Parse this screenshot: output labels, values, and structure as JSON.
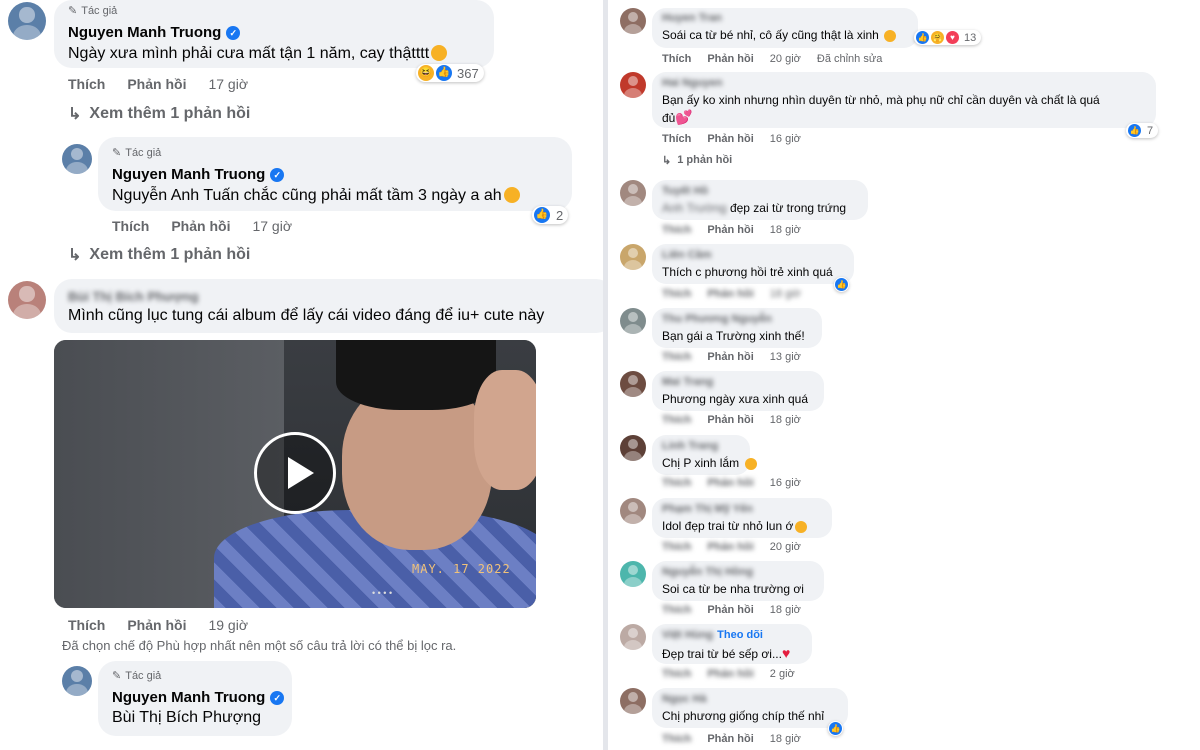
{
  "left": {
    "c1": {
      "author_tag": "Tác giả",
      "name": "Nguyen Manh Truong",
      "text": "Ngày xưa mình phải cưa mất tận 1 năm, cay thậtttt",
      "reaction_count": "367",
      "like": "Thích",
      "reply": "Phản hồi",
      "time": "17 giờ",
      "more": "Xem thêm 1 phản hồi"
    },
    "c2": {
      "author_tag": "Tác giả",
      "name": "Nguyen Manh Truong",
      "mention": "Nguyễn Anh Tuấn",
      "text": "chắc cũng phải mất tầm 3 ngày a ah",
      "reaction_count": "2",
      "like": "Thích",
      "reply": "Phản hồi",
      "time": "17 giờ",
      "more": "Xem thêm 1 phản hồi"
    },
    "c3": {
      "name": "Bùi Thị Bích Phượng",
      "text": "Mình cũng lục tung cái album để lấy cái video đáng để iu+ cute này",
      "video_stamp": "MAY. 17 2022",
      "video_dots": "• • • •",
      "like": "Thích",
      "reply": "Phản hồi",
      "time": "19 giờ",
      "filter_note": "Đã chọn chế độ Phù hợp nhất nên một số câu trả lời có thể bị lọc ra."
    },
    "c4": {
      "author_tag": "Tác giả",
      "name": "Nguyen Manh Truong",
      "mention": "Bùi Thị Bích Phượng"
    }
  },
  "right": {
    "comments": [
      {
        "name": "Huyen Tran",
        "text": "Soái ca từ bé nhỉ, cô ấy cũng thật là xinh",
        "like": "Thích",
        "reply": "Phản hồi",
        "time": "20 giờ",
        "extra": "Đã chỉnh sửa",
        "reaction_count": "13"
      },
      {
        "name": "Hai Nguyen",
        "text": "Bạn ấy ko xinh nhưng nhìn duyên từ nhỏ, mà phụ nữ chỉ cần duyên và chất là quá",
        "text2": "đủ",
        "like": "Thích",
        "reply": "Phản hồi",
        "time": "16 giờ",
        "reaction_count": "7",
        "more": "1 phản hồi"
      },
      {
        "name": "Tuyết Hồ",
        "text_blur": "Anh Trường",
        "text": "đẹp zai từ trong trứng",
        "like": "Thích",
        "reply": "Phản hồi",
        "time": "18 giờ"
      },
      {
        "name": "Liên Cầm",
        "text": "Thích c phương hồi trẻ xinh quá",
        "like": "Thích",
        "reply": "Phản hồi",
        "time": "18 giờ"
      },
      {
        "name": "Thu Phương Nguyễn",
        "text": "Bạn gái a Trường xinh thế!",
        "like": "Thích",
        "reply": "Phản hồi",
        "time": "13 giờ"
      },
      {
        "name": "Mai Trang",
        "text": "Phương ngày xưa xinh quá",
        "like": "Thích",
        "reply": "Phản hồi",
        "time": "18 giờ"
      },
      {
        "name": "Linh Trang",
        "text": "Chị P xinh lắm",
        "like": "Thích",
        "reply": "Phản hồi",
        "time": "16 giờ"
      },
      {
        "name": "Phạm Thị Mỹ Yến",
        "text": "Idol đẹp trai từ nhỏ lun ớ",
        "like": "Thích",
        "reply": "Phản hồi",
        "time": "20 giờ"
      },
      {
        "name": "Nguyễn Thị Hồng",
        "text": "Soi ca từ be nha trường ơi",
        "like": "Thích",
        "reply": "Phản hồi",
        "time": "18 giờ"
      },
      {
        "name": "Việt Hùng",
        "follow": "Theo dõi",
        "text": "Đẹp trai từ bé sếp ơi...",
        "like": "Thích",
        "reply": "Phản hồi",
        "time": "2 giờ"
      },
      {
        "name": "Ngọc Hà",
        "text": "Chị phương giống chíp thế nhỉ",
        "like": "Thích",
        "reply": "Phản hồi",
        "time": "18 giờ"
      }
    ]
  },
  "colors": {
    "bubble": "#f0f2f5",
    "accent": "#1877f2",
    "secondary_text": "#65676b",
    "divider": "#e4e6eb"
  },
  "icons": [
    "pencil-icon",
    "verified-icon",
    "reply-arrow-icon",
    "like-reaction-icon",
    "haha-reaction-icon",
    "love-reaction-icon",
    "play-icon",
    "heart-emoji-icon"
  ]
}
